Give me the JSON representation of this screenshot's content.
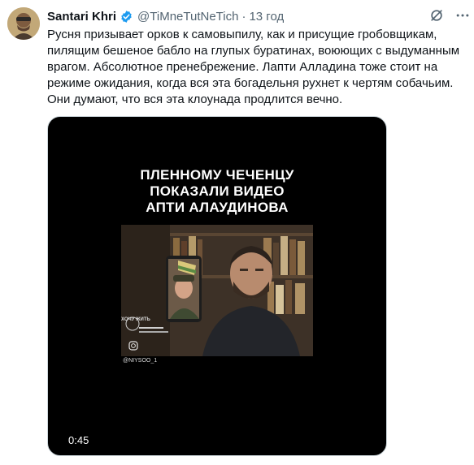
{
  "tweet": {
    "author_name": "Santari Khri",
    "author_handle": "@TiMneTutNeTich",
    "separator": "·",
    "time": "13 год",
    "text": "Русня призывает орков к самовыпилу, как и присущие гробовщикам,\nпилящим бешеное бабло на глупых буратинах, воюющих с выдуманным\nврагом. Абсолютное пренебрежение. Лапти Алладина тоже стоит  на\nрежиме ожидания, когда вся эта богадельня рухнет к чертям собачьим.\nОни думают, что вся эта клоунада продлится вечно."
  },
  "media": {
    "caption": "ПЛЕННОМУ ЧЕЧЕНЦУ\nПОКАЗАЛИ ВИДЕО\nАПТИ АЛАУДИНОВА",
    "watermark_small": "ХОЧУ ЖИТЬ",
    "watermark_handle": "@NIYSOO_1",
    "duration": "0:45"
  },
  "icons": {
    "verified": "verified-badge-icon",
    "grok": "grok-icon",
    "more": "more-options-icon"
  },
  "colors": {
    "verified": "#1d9bf0",
    "secondary_text": "#536471",
    "media_bg": "#000000"
  }
}
